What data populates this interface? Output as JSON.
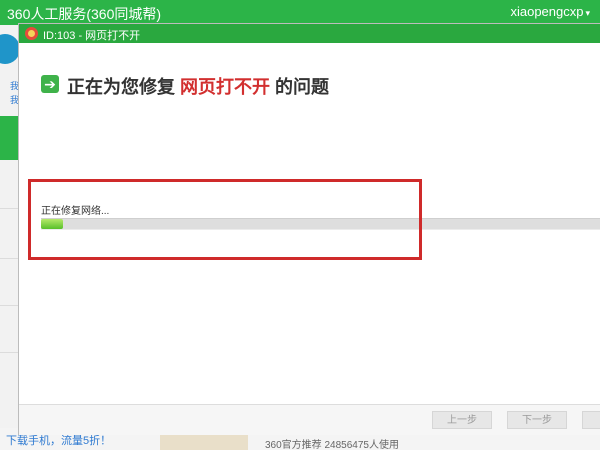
{
  "background_window": {
    "title": "360人工服务(360同城帮)",
    "username": "xiaopengcxp",
    "left_snippet_1": "我",
    "left_snippet_2": "我",
    "bottom_link": "下载手机，流量5折！",
    "bottom_text": "360官方推荐  24856475人使用"
  },
  "dialog": {
    "title": "ID:103 - 网页打不开",
    "heading_prefix": "正在为您修复",
    "heading_highlight": "网页打不开",
    "heading_suffix": "的问题",
    "status_text": "正在修复网络...",
    "progress_fraction": 0.04,
    "prev_button": "上一步",
    "next_button": "下一步"
  },
  "colors": {
    "brand_green": "#2cb448",
    "highlight_red": "#cf2a2a"
  },
  "icons": [
    "lifebuoy-icon",
    "arrow-right-icon",
    "dropdown-caret-icon"
  ]
}
